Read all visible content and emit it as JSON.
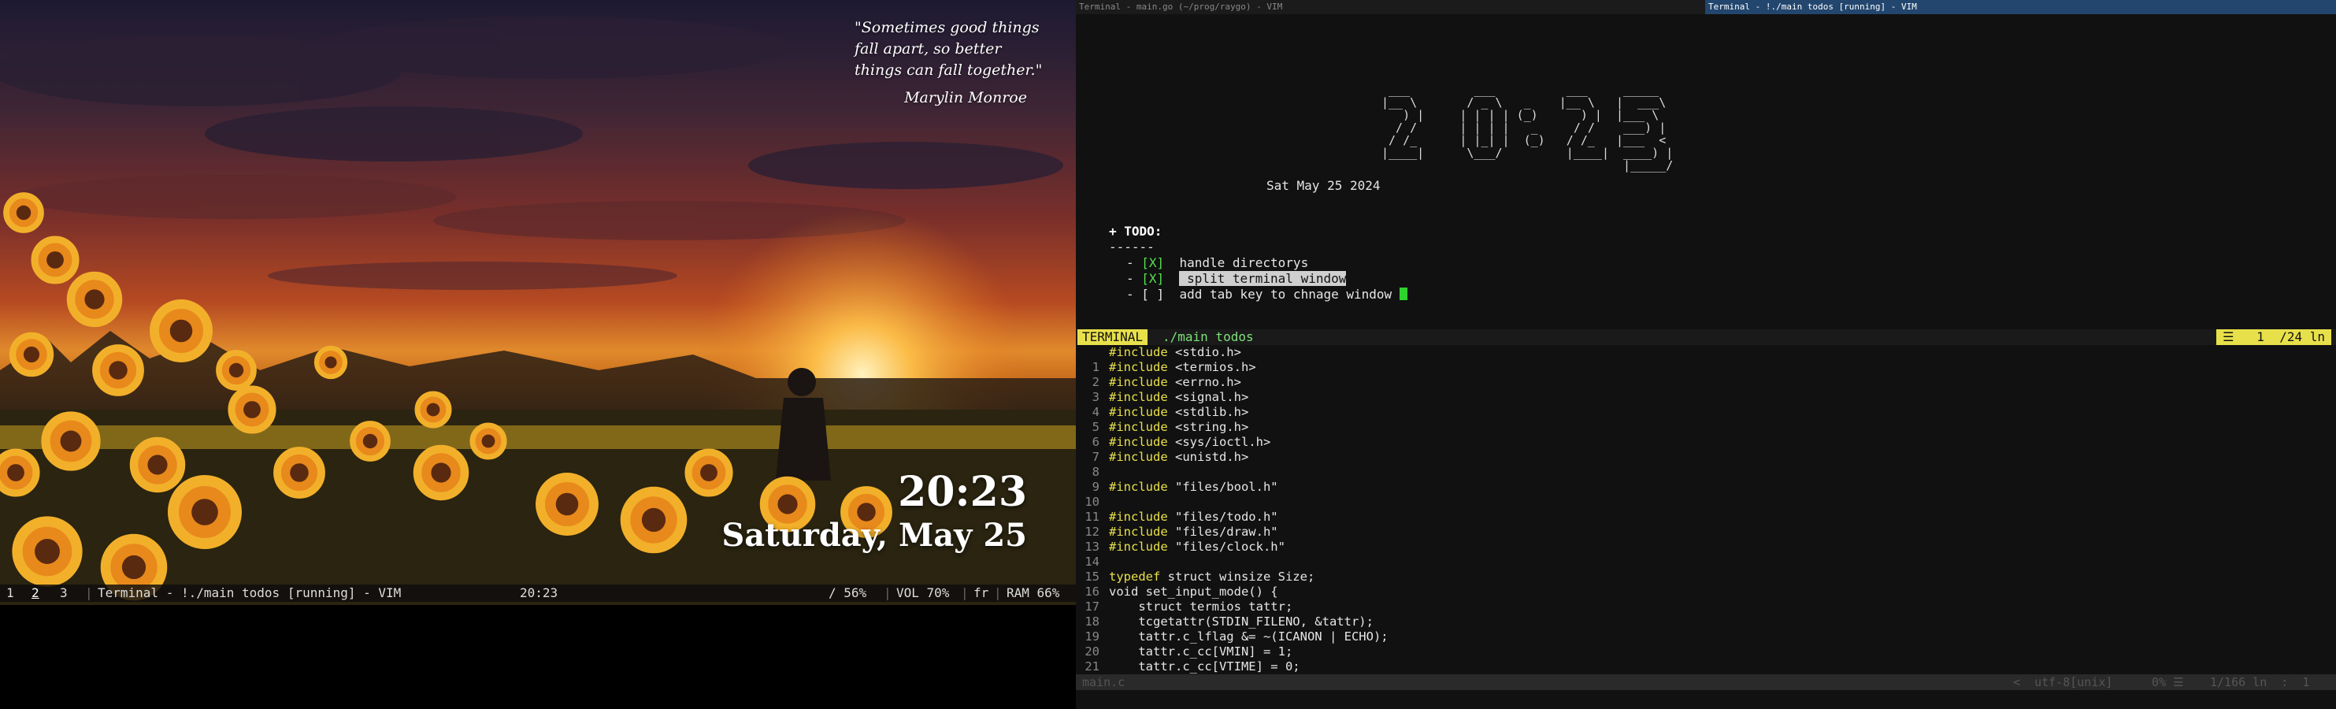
{
  "wallpaper": {
    "quote": "\"Sometimes good things fall apart, so better things can fall together.\"",
    "quote_author": "Marylin Monroe",
    "time": "20:23",
    "date": "Saturday, May 25"
  },
  "statusbar": {
    "workspaces": [
      "1",
      "2",
      "3"
    ],
    "active_workspace": "2",
    "window_title": "Terminal - !./main todos [running] - VIM",
    "clock": "20:23",
    "disk": "/ 56%",
    "volume": "VOL 70%",
    "layout": "fr",
    "ram": "RAM 66%"
  },
  "vim": {
    "titles": {
      "left": "Terminal - main.go (~/prog/raygo) - VIM",
      "right": "Terminal - !./main todos [running] - VIM"
    },
    "clock_ascii": [
      " ___         ___          ___     _____ ",
      "|__ \\       / _ \\   _    |__ \\   |  ___\\",
      "   ) |     | | | | (_)      ) |  |___ \\ ",
      "  / /      | | | |   _     / /    ___) |",
      " / /_      | |_| |  (_)   / /_   |___  <",
      "|____|      \\___/         |____|  ____) |",
      "                                  |_____/ "
    ],
    "date": "Sat May 25 2024",
    "todo_header": "+ TODO:",
    "todo_rule": "------",
    "todos": [
      {
        "mark": "[X]",
        "text": "handle directorys",
        "highlighted": false
      },
      {
        "mark": "[X]",
        "text": "split terminal window",
        "highlighted": true
      },
      {
        "mark": "[ ]",
        "text": "add tab key to chnage window",
        "highlighted": false
      }
    ],
    "terminal_status": {
      "badge": "TERMINAL",
      "command": "./main todos",
      "position": "☰   1  /24 ln"
    },
    "code_first_line": "#include <stdio.h>",
    "code": [
      {
        "n": "1",
        "type": "inc",
        "kw": "#include",
        "rest": " <termios.h>"
      },
      {
        "n": "2",
        "type": "inc",
        "kw": "#include",
        "rest": " <errno.h>"
      },
      {
        "n": "3",
        "type": "inc",
        "kw": "#include",
        "rest": " <signal.h>"
      },
      {
        "n": "4",
        "type": "inc",
        "kw": "#include",
        "rest": " <stdlib.h>"
      },
      {
        "n": "5",
        "type": "inc",
        "kw": "#include",
        "rest": " <string.h>"
      },
      {
        "n": "6",
        "type": "inc",
        "kw": "#include",
        "rest": " <sys/ioctl.h>"
      },
      {
        "n": "7",
        "type": "inc",
        "kw": "#include",
        "rest": " <unistd.h>"
      },
      {
        "n": "8",
        "type": "blank",
        "kw": "",
        "rest": ""
      },
      {
        "n": "9",
        "type": "inc",
        "kw": "#include",
        "rest": " \"files/bool.h\""
      },
      {
        "n": "10",
        "type": "blank",
        "kw": "",
        "rest": ""
      },
      {
        "n": "11",
        "type": "inc",
        "kw": "#include",
        "rest": " \"files/todo.h\""
      },
      {
        "n": "12",
        "type": "inc",
        "kw": "#include",
        "rest": " \"files/draw.h\""
      },
      {
        "n": "13",
        "type": "inc",
        "kw": "#include",
        "rest": " \"files/clock.h\""
      },
      {
        "n": "14",
        "type": "blank",
        "kw": "",
        "rest": ""
      },
      {
        "n": "15",
        "type": "kw",
        "kw": "typedef",
        "rest": " struct winsize Size;"
      },
      {
        "n": "16",
        "type": "plain",
        "kw": "",
        "rest": "void set_input_mode() {"
      },
      {
        "n": "17",
        "type": "plain",
        "kw": "",
        "rest": "    struct termios tattr;"
      },
      {
        "n": "18",
        "type": "plain",
        "kw": "",
        "rest": "    tcgetattr(STDIN_FILENO, &tattr);"
      },
      {
        "n": "19",
        "type": "plain",
        "kw": "",
        "rest": "    tattr.c_lflag &= ~(ICANON | ECHO);"
      },
      {
        "n": "20",
        "type": "plain",
        "kw": "",
        "rest": "    tattr.c_cc[VMIN] = 1;"
      },
      {
        "n": "21",
        "type": "plain",
        "kw": "",
        "rest": "    tattr.c_cc[VTIME] = 0;"
      }
    ],
    "bottom_status": {
      "file": "main.c",
      "encoding": "<  utf-8[unix]",
      "percent": "0% ☰",
      "position": "1/166 ln  :  1"
    }
  }
}
